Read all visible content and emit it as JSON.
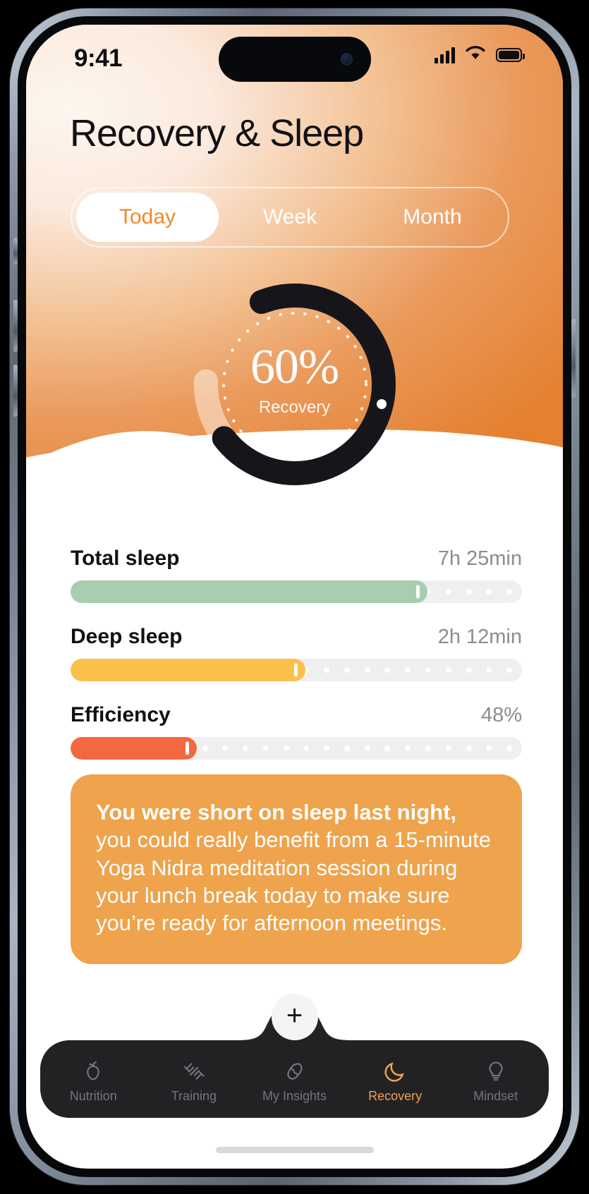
{
  "status_bar": {
    "time": "9:41",
    "signal_icon": "cellular-signal-icon",
    "wifi_icon": "wifi-icon",
    "battery_icon": "battery-full-icon"
  },
  "header": {
    "title": "Recovery & Sleep"
  },
  "segmented_control": {
    "options": [
      {
        "label": "Today",
        "active": true
      },
      {
        "label": "Week",
        "active": false
      },
      {
        "label": "Month",
        "active": false
      }
    ],
    "active_color": "#ef8a2b"
  },
  "recovery_gauge": {
    "value_text": "60%",
    "label": "Recovery",
    "percent": 60,
    "arc_color": "#16161a",
    "track_color": "rgba(255,255,255,0.45)",
    "dotted_inner_ring": true
  },
  "metrics": [
    {
      "name": "Total sleep",
      "value": "7h 25min",
      "percent": 79,
      "color": "#a8cdb0",
      "dots": 22
    },
    {
      "name": "Deep sleep",
      "value": "2h 12min",
      "percent": 52,
      "color": "#fbc04a",
      "dots": 22
    },
    {
      "name": "Efficiency",
      "value": "48%",
      "percent": 28,
      "color": "#f2683f",
      "dots": 22
    }
  ],
  "insight_card": {
    "bold_text": "You were short on sleep last night,",
    "rest_text": " you could really benefit from a 15-minute Yoga Nidra meditation session during your lunch break today to make sure you’re ready for afternoon meetings.",
    "background_color": "#eea34c"
  },
  "fab": {
    "label": "+",
    "icon": "plus-icon"
  },
  "bottom_nav": {
    "items": [
      {
        "label": "Nutrition",
        "icon": "apple-icon",
        "active": false
      },
      {
        "label": "Training",
        "icon": "dumbbell-icon",
        "active": false
      },
      {
        "label": "My Insights",
        "icon": "brain-icon",
        "active": false
      },
      {
        "label": "Recovery",
        "icon": "moon-icon",
        "active": true
      },
      {
        "label": "Mindset",
        "icon": "lightbulb-icon",
        "active": false
      }
    ],
    "active_color": "#eea34c",
    "inactive_color": "#75757a",
    "background_color": "#222225"
  }
}
